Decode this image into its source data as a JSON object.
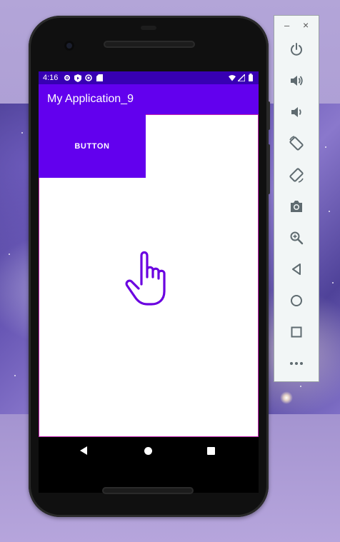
{
  "status_bar": {
    "time": "4:16"
  },
  "app_bar": {
    "title": "My Application_9"
  },
  "content": {
    "button_label": "BUTTON"
  },
  "toolbar": {
    "minimize_label": "–",
    "close_label": "×",
    "items": [
      {
        "icon": "power-icon"
      },
      {
        "icon": "volume-up-icon"
      },
      {
        "icon": "volume-down-icon"
      },
      {
        "icon": "rotate-left-icon"
      },
      {
        "icon": "rotate-right-icon"
      },
      {
        "icon": "camera-icon"
      },
      {
        "icon": "zoom-icon"
      },
      {
        "icon": "back-icon"
      },
      {
        "icon": "home-icon"
      },
      {
        "icon": "overview-icon"
      },
      {
        "icon": "more-icon"
      }
    ]
  },
  "colors": {
    "primary": "#6200ee",
    "primary_dark": "#3700b3",
    "toolbar_icon": "#5f6b70"
  }
}
